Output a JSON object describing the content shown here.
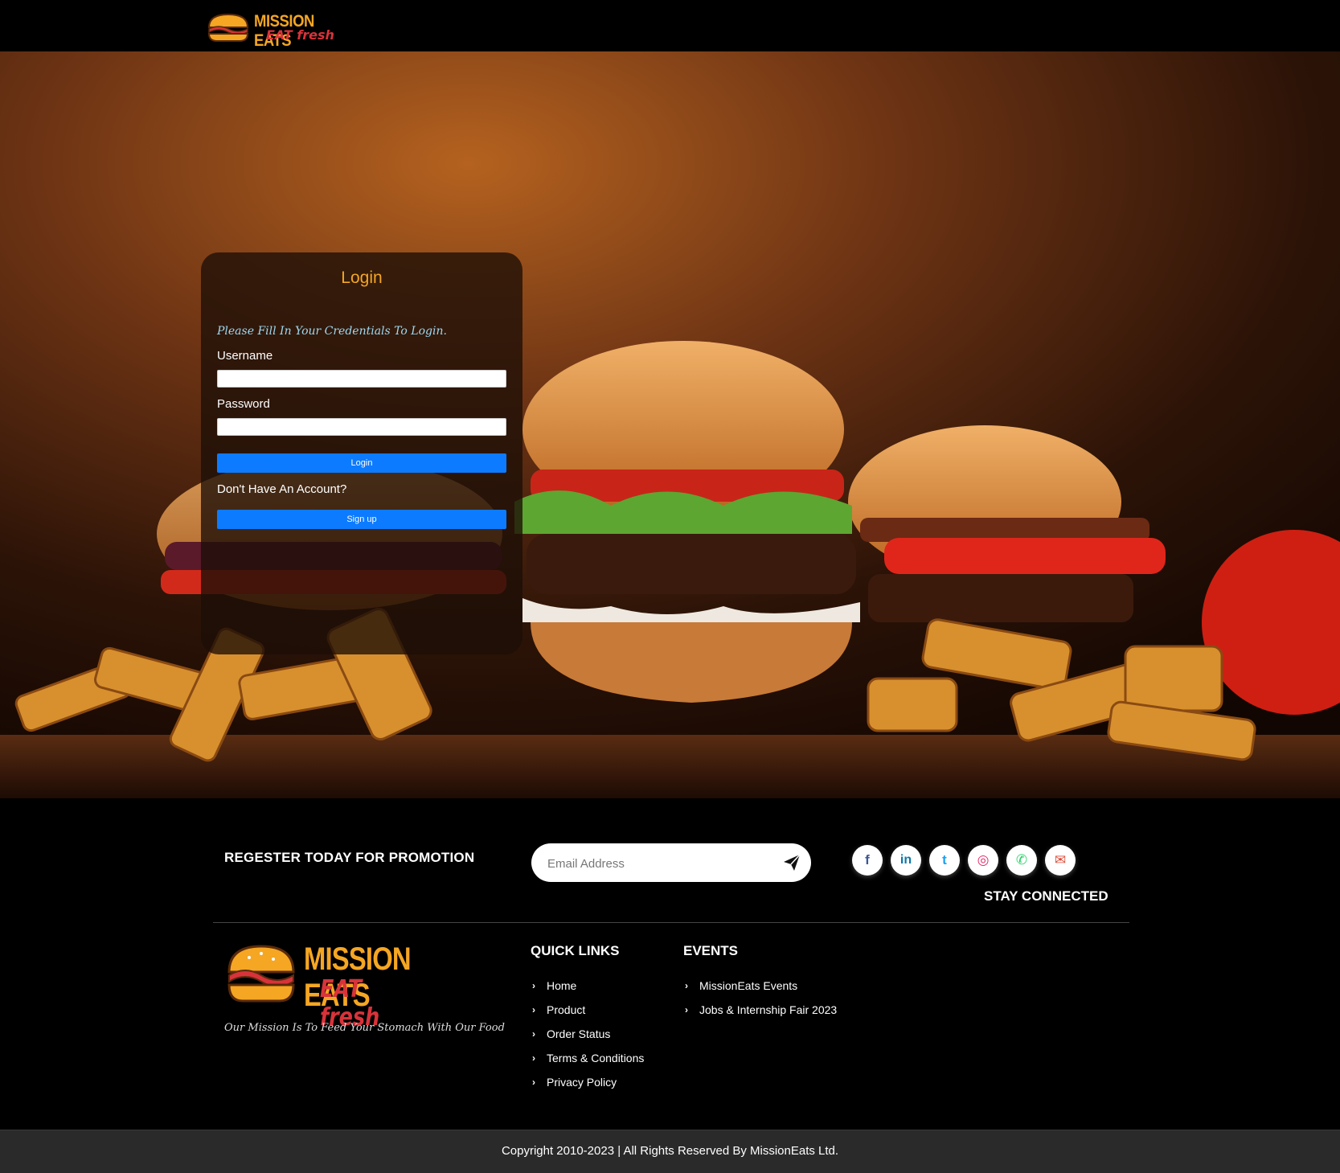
{
  "brand": {
    "name": "MISSION EATS",
    "tagline": "EAT fresh"
  },
  "login": {
    "title": "Login",
    "hint": "Please Fill In Your Credentials To Login.",
    "username_label": "Username",
    "username_value": "",
    "password_label": "Password",
    "password_value": "",
    "login_button": "Login",
    "no_account_text": "Don't Have An Account?",
    "signup_button": "Sign up"
  },
  "footer": {
    "promo_text": "REGESTER TODAY FOR PROMOTION",
    "email_placeholder": "Email Address",
    "send_icon": "paper-plane-icon",
    "socials": [
      {
        "name": "facebook-icon",
        "glyph": "f",
        "color": "#3b5998"
      },
      {
        "name": "linkedin-icon",
        "glyph": "in",
        "color": "#0e76a8"
      },
      {
        "name": "twitter-icon",
        "glyph": "t",
        "color": "#1da1f2"
      },
      {
        "name": "instagram-icon",
        "glyph": "◎",
        "color": "#e1306c"
      },
      {
        "name": "whatsapp-icon",
        "glyph": "✆",
        "color": "#25d366"
      },
      {
        "name": "email-icon",
        "glyph": "✉",
        "color": "#dd4b39"
      }
    ],
    "stay_connected": "STAY CONNECTED",
    "mission": "Our Mission Is To Feed Your Stomach With Our Food",
    "quick_links": {
      "heading": "QUICK LINKS",
      "items": [
        "Home",
        "Product",
        "Order Status",
        "Terms & Conditions",
        "Privacy Policy"
      ]
    },
    "events": {
      "heading": "EVENTS",
      "items": [
        "MissionEats Events",
        "Jobs & Internship Fair 2023"
      ]
    },
    "copyright": "Copyright 2010-2023 | All Rights Reserved By MissionEats Ltd."
  },
  "colors": {
    "accent": "#f5a623",
    "brand_red": "#d8333a",
    "button_blue": "#0d7bff"
  }
}
